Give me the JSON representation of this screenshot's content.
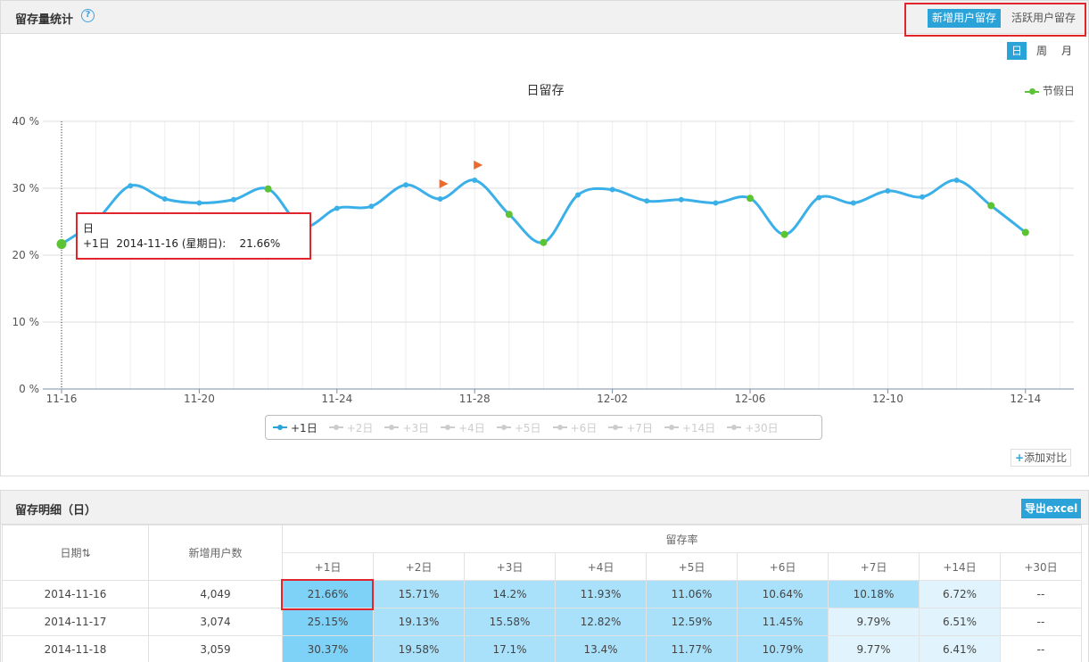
{
  "retention_panel": {
    "title": "留存量统计",
    "help_icon": "?",
    "tabs": {
      "new_users": "新增用户留存",
      "active_users": "活跃用户留存"
    },
    "periods": [
      "日",
      "周",
      "月"
    ],
    "selected_period": "日",
    "add_compare": "添加对比",
    "add_compare_plus": "+"
  },
  "chart_data": {
    "type": "line",
    "title": "日留存",
    "x_ticks": [
      "11-16",
      "11-20",
      "11-24",
      "11-28",
      "12-02",
      "12-06",
      "12-10",
      "12-14"
    ],
    "y_ticks": [
      "0 %",
      "10 %",
      "20 %",
      "30 %",
      "40 %"
    ],
    "ylim": [
      0,
      40
    ],
    "dates": [
      "11-16",
      "11-17",
      "11-18",
      "11-19",
      "11-20",
      "11-21",
      "11-22",
      "11-23",
      "11-24",
      "11-25",
      "11-26",
      "11-27",
      "11-28",
      "11-29",
      "11-30",
      "12-01",
      "12-02",
      "12-03",
      "12-04",
      "12-05",
      "12-06",
      "12-07",
      "12-08",
      "12-09",
      "12-10",
      "12-11",
      "12-12",
      "12-13",
      "12-14"
    ],
    "series": [
      {
        "name": "+1日",
        "color": "#3bb0e8",
        "values": [
          21.66,
          25.15,
          30.37,
          28.4,
          27.8,
          28.3,
          29.9,
          24.3,
          27.0,
          27.3,
          30.5,
          28.4,
          31.2,
          26.1,
          21.9,
          29.0,
          29.8,
          28.1,
          28.3,
          27.8,
          28.5,
          23.1,
          28.6,
          27.8,
          29.6,
          28.7,
          31.2,
          27.4,
          23.4
        ]
      }
    ],
    "legend_series": [
      "+1日",
      "+2日",
      "+3日",
      "+4日",
      "+5日",
      "+6日",
      "+7日",
      "+14日",
      "+30日"
    ],
    "holiday_legend": "节假日",
    "holiday_color": "#5cc334",
    "holiday_indices": [
      0,
      6,
      13,
      14,
      20,
      21,
      27,
      28
    ],
    "flag_indices": [
      11,
      12
    ],
    "flag_color": "#ee6a2c",
    "grid": true
  },
  "tooltip": {
    "title": "日",
    "line": "+1日  2014-11-16 (星期日):    21.66%"
  },
  "detail_panel": {
    "title": "留存明细（日）",
    "export_label": "导出excel",
    "columns": {
      "date": "日期⇅",
      "new_users": "新增用户数",
      "retention_rate": "留存率",
      "days": [
        "+1日",
        "+2日",
        "+3日",
        "+4日",
        "+5日",
        "+6日",
        "+7日",
        "+14日",
        "+30日"
      ]
    },
    "rows": [
      {
        "date": "2014-11-16",
        "new_users": "4,049",
        "rates": [
          "21.66%",
          "15.71%",
          "14.2%",
          "11.93%",
          "11.06%",
          "10.64%",
          "10.18%",
          "6.72%",
          "--"
        ]
      },
      {
        "date": "2014-11-17",
        "new_users": "3,074",
        "rates": [
          "25.15%",
          "19.13%",
          "15.58%",
          "12.82%",
          "12.59%",
          "11.45%",
          "9.79%",
          "6.51%",
          "--"
        ]
      },
      {
        "date": "2014-11-18",
        "new_users": "3,059",
        "rates": [
          "30.37%",
          "19.58%",
          "17.1%",
          "13.4%",
          "11.77%",
          "10.79%",
          "9.77%",
          "6.41%",
          "--"
        ]
      }
    ]
  }
}
